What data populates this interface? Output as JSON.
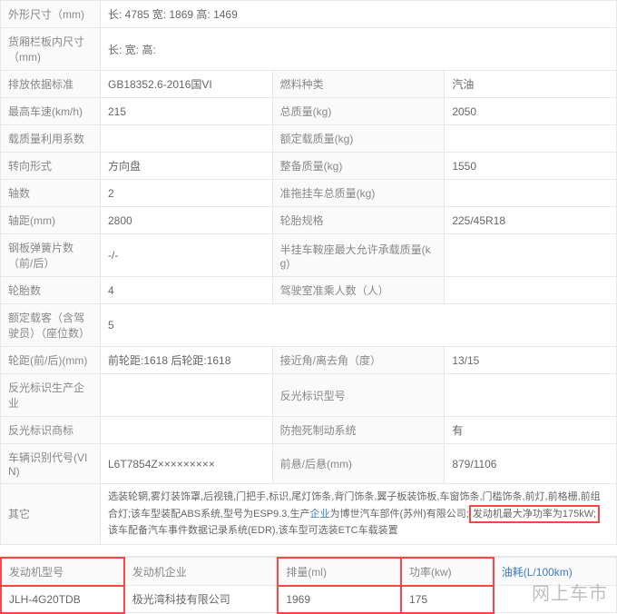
{
  "labels": {
    "exterior_dim": "外形尺寸（mm)",
    "cargo_dim": "货厢栏板内尺寸（mm)",
    "emission_std": "排放依据标准",
    "fuel_type": "燃料种类",
    "max_speed": "最高车速(km/h)",
    "total_mass": "总质量(kg)",
    "load_util": "载质量利用系数",
    "rated_payload": "额定载质量(kg)",
    "steering": "转向形式",
    "curb_mass": "整备质量(kg)",
    "axles": "轴数",
    "trailer_mass": "准拖挂车总质量(kg)",
    "wheelbase": "轴距(mm)",
    "tire_spec": "轮胎规格",
    "spring": "钢板弹簧片数（前/后）",
    "semi_saddle": "半挂车鞍座最大允许承载质量(kg)",
    "tires": "轮胎数",
    "cabin_seats": "驾驶室准乘人数（人）",
    "rated_pass": "额定载客（含驾驶员）（座位数）",
    "track": "轮距(前/后)(mm)",
    "approach": "接近角/离去角（度）",
    "reflector_mfr": "反光标识生产企业",
    "reflector_model": "反光标识型号",
    "reflector_brand": "反光标识商标",
    "abs": "防抱死制动系统",
    "vin": "车辆识别代号(VIN)",
    "overhang": "前悬/后悬(mm)",
    "other": "其它",
    "engine_model": "发动机型号",
    "engine_mfr": "发动机企业",
    "displacement": "排量(ml)",
    "power": "功率(kw)",
    "fuel_consumption_link": "油耗(L/100km)"
  },
  "values": {
    "exterior_dim": "长: 4785 宽: 1869 高: 1469",
    "cargo_dim": "长:  宽:  高:",
    "emission_std": "GB18352.6-2016国VI",
    "fuel_type": "汽油",
    "max_speed": "215",
    "total_mass": "2050",
    "load_util": "",
    "rated_payload": "",
    "steering": "方向盘",
    "curb_mass": "1550",
    "axles": "2",
    "trailer_mass": "",
    "wheelbase": "2800",
    "tire_spec": "225/45R18",
    "spring": "-/-",
    "semi_saddle": "",
    "tires": "4",
    "cabin_seats": "",
    "rated_pass": "5",
    "track": "前轮距:1618 后轮距:1618",
    "approach": "13/15",
    "reflector_mfr": "",
    "reflector_model": "",
    "reflector_brand": "",
    "abs": "有",
    "vin": "L6T7854Z×××××××××",
    "overhang": "879/1106",
    "other_pre": "选装轮辋,雾灯装饰罩,后视镜,门把手,标识,尾灯饰条,背门饰条,翼子板装饰板,车窗饰条,门槛饰条,前灯,前格栅,前组合灯;该车型装配ABS系统,型号为ESP9.3,生产",
    "other_link": "企业",
    "other_mid": "为博世汽车部件(苏州)有限公司;",
    "other_hl": "发动机最大净功率为175kW;",
    "other_post": "该车配备汽车事件数据记录系统(EDR),该车型可选装ETC车载装置",
    "engine_model": "JLH-4G20TDB",
    "engine_mfr": "极光湾科技有限公司",
    "displacement": "1969",
    "power": "175",
    "fuel_consumption": ""
  },
  "watermark": "网上车市"
}
